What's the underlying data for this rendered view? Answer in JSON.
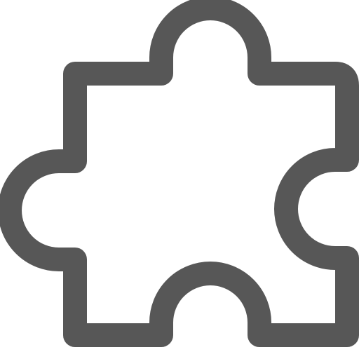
{
  "icon": {
    "name": "puzzle-piece-icon",
    "stroke_color": "#575757",
    "fill_color": "#ffffff"
  }
}
